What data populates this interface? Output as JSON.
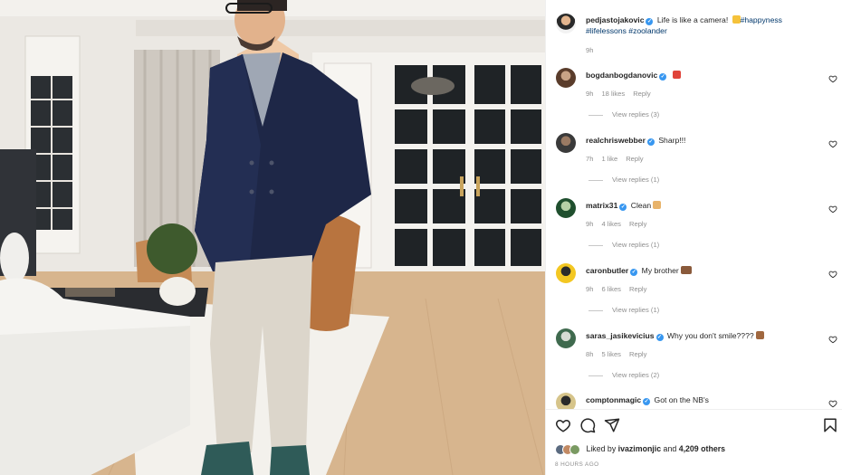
{
  "post": {
    "author": "pedjastojakovic",
    "caption": "Life is like a camera! ",
    "caption_emoji": "sunglasses-emoji",
    "hashtags": [
      "#happyness",
      "#lifelessons",
      "#zoolander"
    ],
    "age": "9h"
  },
  "comments": [
    {
      "username": "bogdanbogdanovic",
      "text": "",
      "emoji": "shoe-emoji",
      "age": "9h",
      "likes": "18 likes",
      "reply": "Reply",
      "view_replies": "View replies (3)"
    },
    {
      "username": "realchriswebber",
      "text": "Sharp!!!",
      "emoji": "",
      "age": "7h",
      "likes": "1 like",
      "reply": "Reply",
      "view_replies": "View replies (1)"
    },
    {
      "username": "matrix31",
      "text": "Clean",
      "emoji": "hands-face-emoji",
      "age": "9h",
      "likes": "4 likes",
      "reply": "Reply",
      "view_replies": "View replies (1)"
    },
    {
      "username": "caronbutler",
      "text": "My brother",
      "emoji": "fist-emoji",
      "age": "9h",
      "likes": "6 likes",
      "reply": "Reply",
      "view_replies": "View replies (1)"
    },
    {
      "username": "saras_jasikevicius",
      "text": "Why you don't smile????",
      "emoji": "monkey-emoji",
      "age": "8h",
      "likes": "5 likes",
      "reply": "Reply",
      "view_replies": "View replies (2)"
    },
    {
      "username": "comptonmagic",
      "text": "Got on the NB's",
      "emoji": "",
      "age": "",
      "likes": "",
      "reply": "",
      "view_replies": ""
    }
  ],
  "actions": {
    "liked_by_prefix": "Liked by",
    "liked_by_user": "ivazimonjic",
    "liked_by_and": "and",
    "liked_by_others": "4,209 others",
    "timestamp": "8 HOURS AGO"
  },
  "colors": {
    "verified": "#3897f0",
    "hashtag": "#00376b",
    "muted": "#8e8e8e",
    "text": "#262626"
  },
  "icons": [
    "heart-icon",
    "comment-icon",
    "share-icon",
    "bookmark-icon",
    "verified-badge-icon"
  ]
}
